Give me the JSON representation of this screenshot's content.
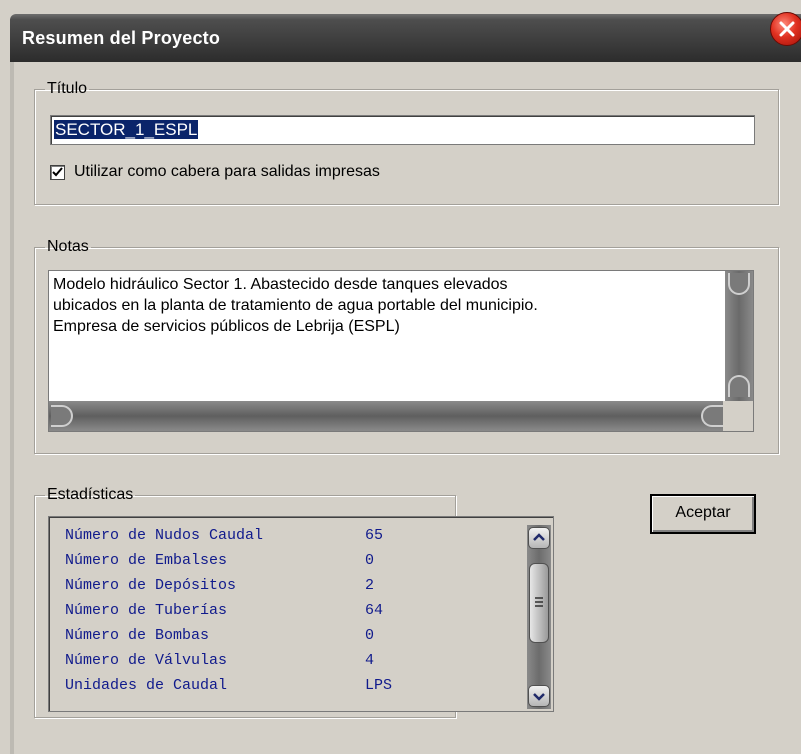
{
  "dialog": {
    "title": "Resumen del Proyecto"
  },
  "titulo_group": {
    "legend": "Título",
    "value": "SECTOR_1_ESPL",
    "checkbox_label": "Utilizar como cabera para salidas impresas",
    "checkbox_checked": true
  },
  "notas_group": {
    "legend": "Notas",
    "lines": [
      "Modelo hidráulico Sector 1. Abastecido desde tanques elevados",
      "ubicados en la planta de tratamiento de agua portable del municipio.",
      "Empresa de servicios públicos de Lebrija (ESPL)"
    ]
  },
  "estadisticas_group": {
    "legend": "Estadísticas",
    "rows": [
      {
        "label": "Número de Nudos Caudal",
        "value": "65"
      },
      {
        "label": "Número de Embalses",
        "value": "0"
      },
      {
        "label": "Número de Depósitos",
        "value": "2"
      },
      {
        "label": "Número de Tuberías",
        "value": "64"
      },
      {
        "label": "Número de Bombas",
        "value": "0"
      },
      {
        "label": "Número de Válvulas",
        "value": "4"
      },
      {
        "label": "Unidades de Caudal",
        "value": "LPS"
      }
    ]
  },
  "buttons": {
    "accept": "Aceptar"
  },
  "colors": {
    "titlebar": "#3c3c3c",
    "dialog_bg": "#d4d0c8",
    "stats_text": "#101a8c",
    "selection": "#0a246a",
    "close_button": "#e03020"
  },
  "icons": {
    "close": "close-icon",
    "checkmark": "checkmark-icon",
    "scroll_up": "chevron-up-icon",
    "scroll_down": "chevron-down-icon",
    "scroll_grip": "grip-icon"
  }
}
